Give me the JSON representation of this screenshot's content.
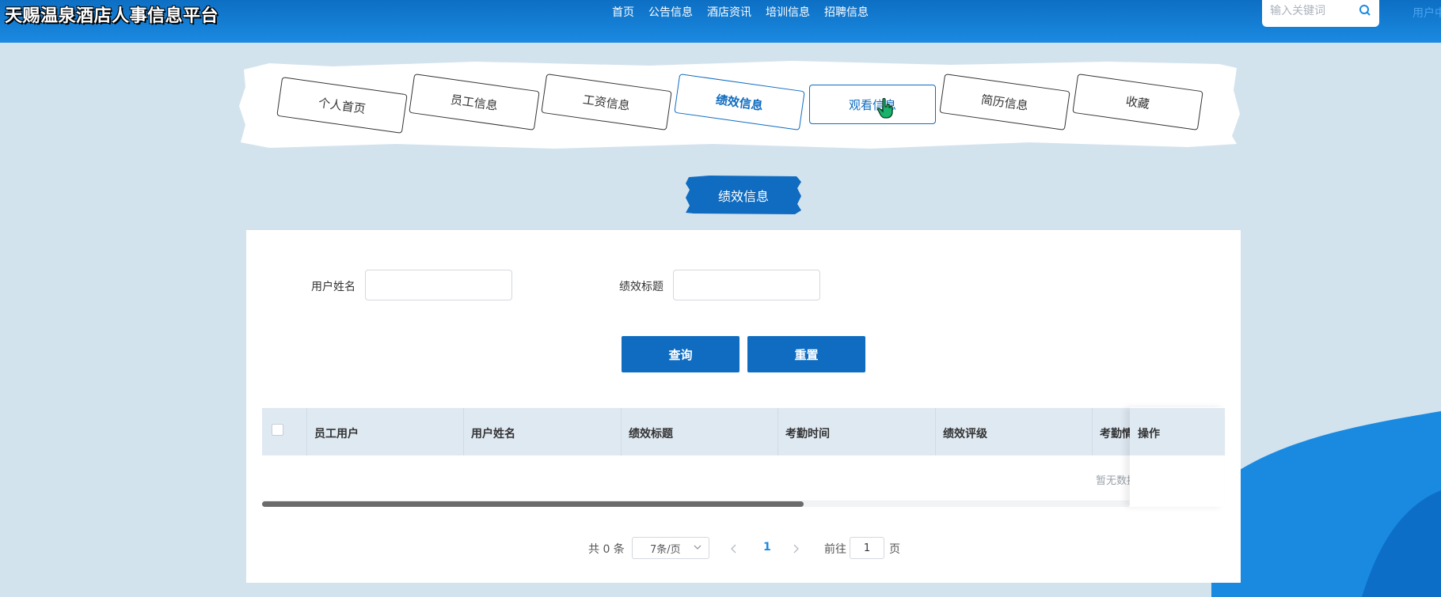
{
  "header": {
    "site_title": "天赐温泉酒店人事信息平台",
    "nav": [
      "首页",
      "公告信息",
      "酒店资讯",
      "培训信息",
      "招聘信息"
    ],
    "search_placeholder": "输入关键词",
    "user_link": "用户中"
  },
  "tabs": [
    {
      "label": "个人首页",
      "state": "normal"
    },
    {
      "label": "员工信息",
      "state": "normal"
    },
    {
      "label": "工资信息",
      "state": "normal"
    },
    {
      "label": "绩效信息",
      "state": "active"
    },
    {
      "label": "观看信息",
      "state": "hover"
    },
    {
      "label": "简历信息",
      "state": "normal"
    },
    {
      "label": "收藏",
      "state": "normal"
    }
  ],
  "section_title": "绩效信息",
  "filters": {
    "user_name_label": "用户姓名",
    "user_name_value": "",
    "title_label": "绩效标题",
    "title_value": ""
  },
  "buttons": {
    "query": "查询",
    "reset": "重置"
  },
  "table": {
    "columns": [
      "员工用户",
      "用户姓名",
      "绩效标题",
      "考勤时间",
      "绩效评级",
      "考勤情"
    ],
    "op_column": "操作",
    "empty_text": "暂无数据"
  },
  "pagination": {
    "total_text": "共 0 条",
    "page_size": "7条/页",
    "current_page": "1",
    "goto_prefix": "前往",
    "goto_value": "1",
    "goto_suffix": "页"
  },
  "colors": {
    "primary": "#0f6cc0",
    "header": "#1a8ae0",
    "background": "#d3e3ee"
  }
}
